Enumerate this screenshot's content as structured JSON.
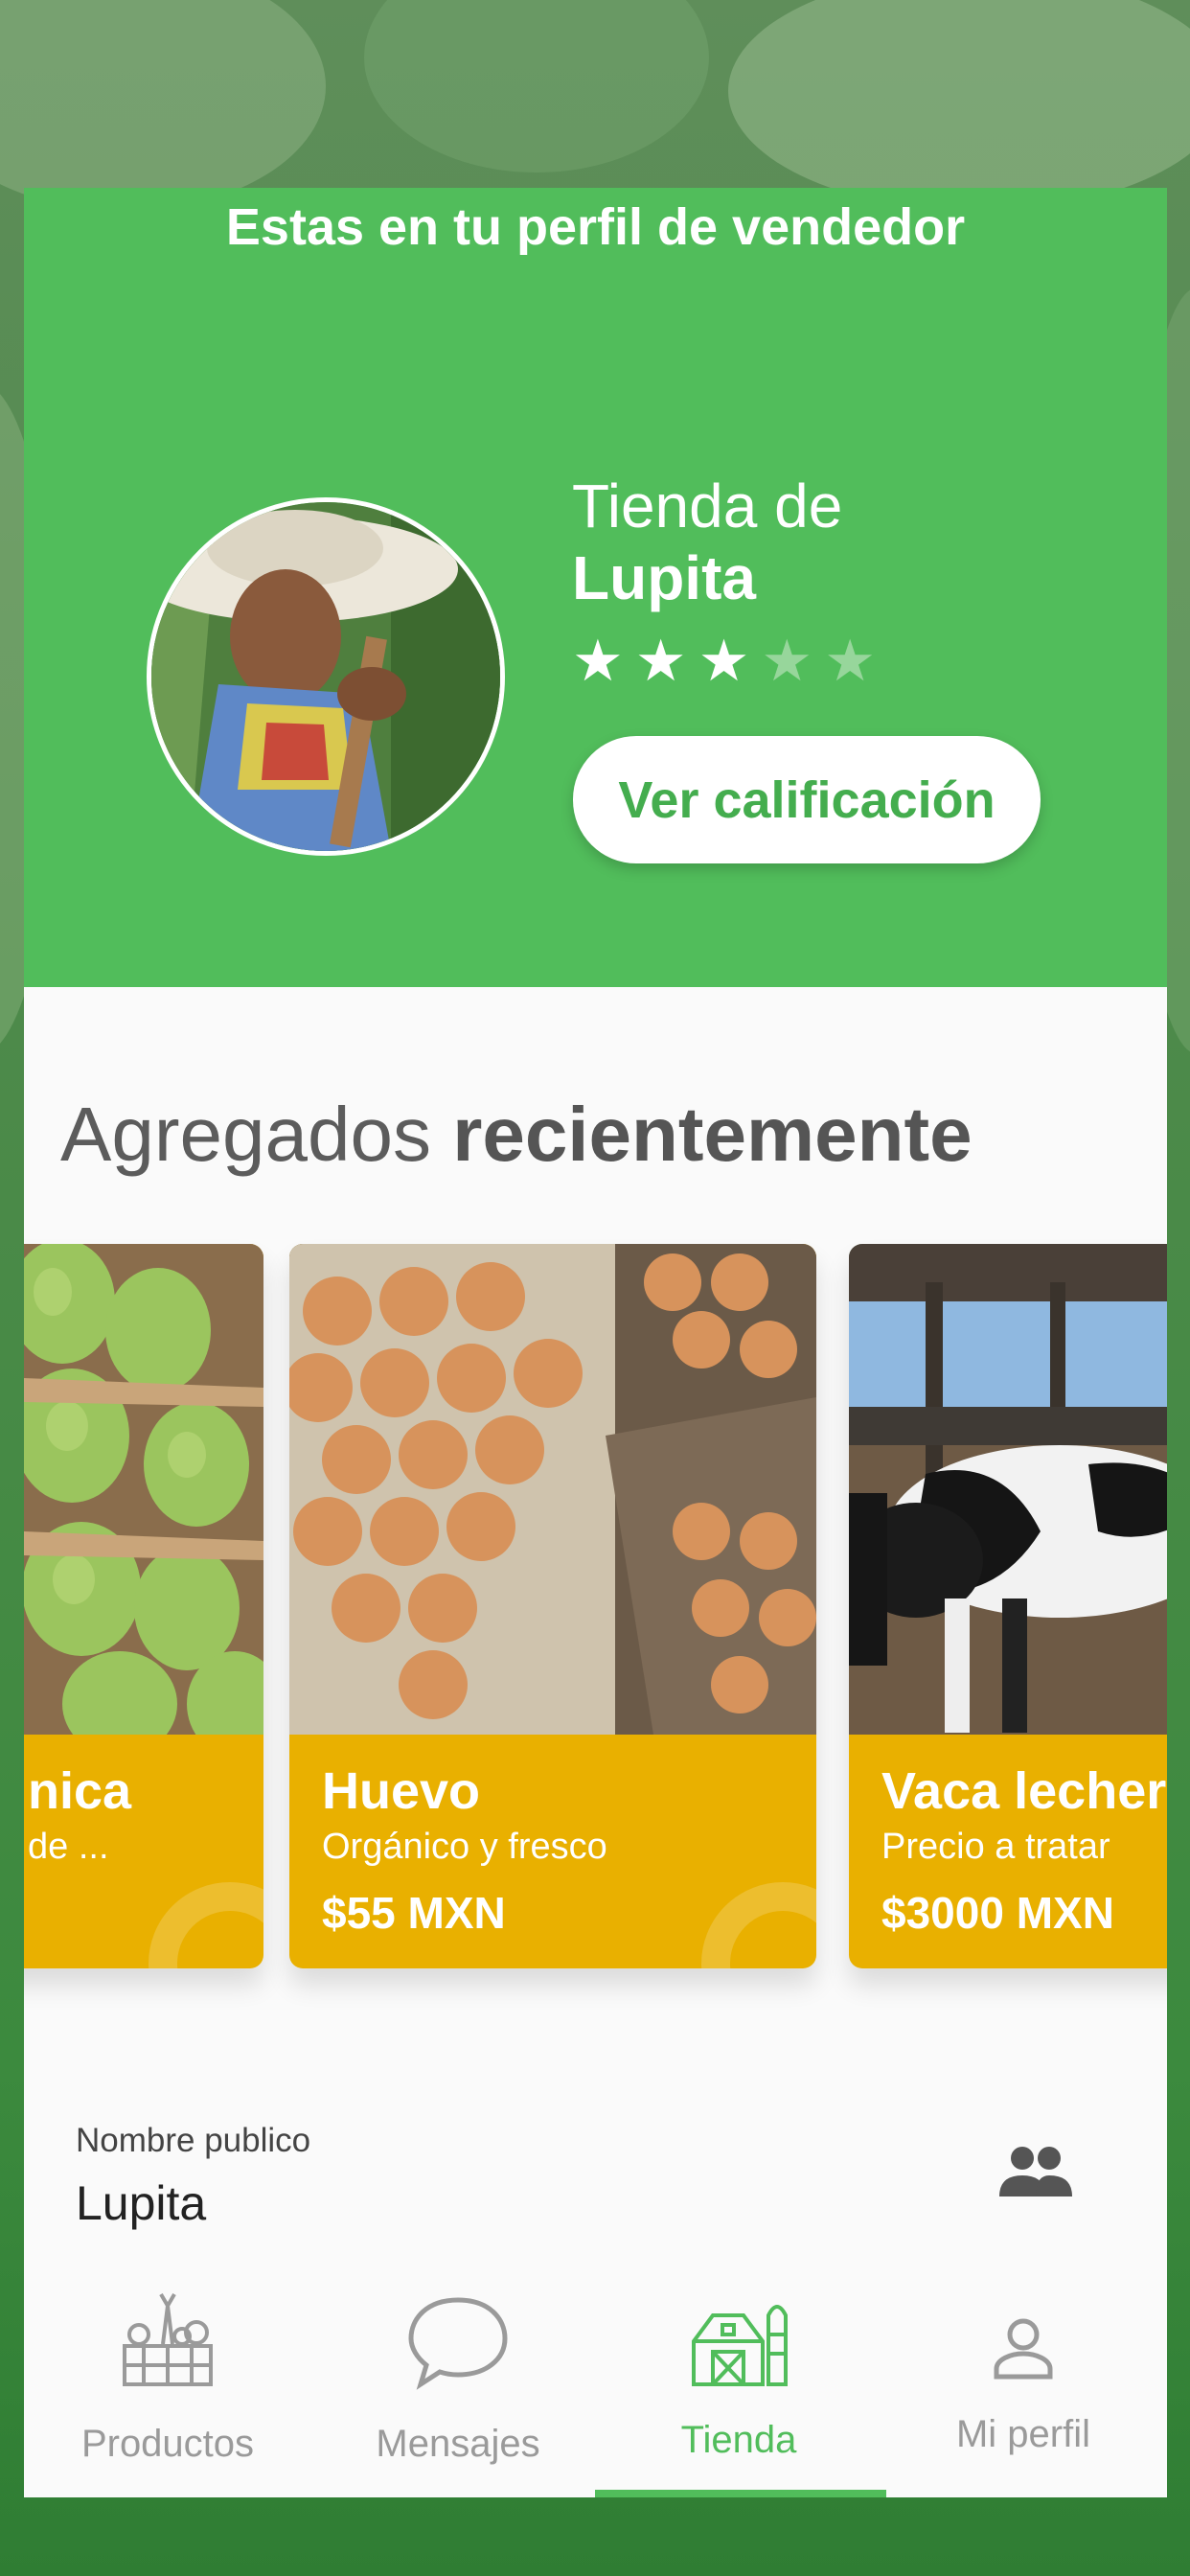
{
  "hero": {
    "banner": "Estas en tu perfil de vendedor",
    "store_prefix": "Tienda de",
    "store_name": "Lupita",
    "rating_stars": 3,
    "rating_max": 5,
    "rate_button": "Ver calificación"
  },
  "recent": {
    "title_regular": "Agregados ",
    "title_bold": "recientemente",
    "products": [
      {
        "name": "nica",
        "subtitle": "de ...",
        "price": "",
        "image": "pears-photo"
      },
      {
        "name": "Huevo",
        "subtitle": "Orgánico y fresco",
        "price": "$55 MXN",
        "image": "eggs-photo"
      },
      {
        "name": "Vaca lecher",
        "subtitle": "Precio a tratar",
        "price": "$3000 MXN",
        "image": "cows-photo"
      }
    ]
  },
  "profile": {
    "public_name_label": "Nombre publico",
    "public_name_value": "Lupita",
    "icon": "people-icon"
  },
  "nav": {
    "items": [
      {
        "label": "Productos",
        "icon": "vegetable-crate-icon",
        "active": false
      },
      {
        "label": "Mensajes",
        "icon": "chat-bubble-icon",
        "active": false
      },
      {
        "label": "Tienda",
        "icon": "barn-icon",
        "active": true
      },
      {
        "label": "Mi perfil",
        "icon": "person-icon",
        "active": false
      }
    ]
  },
  "colors": {
    "primary_green": "#51bd5b",
    "card_yellow": "#e9b000",
    "background": "#fafafa"
  }
}
